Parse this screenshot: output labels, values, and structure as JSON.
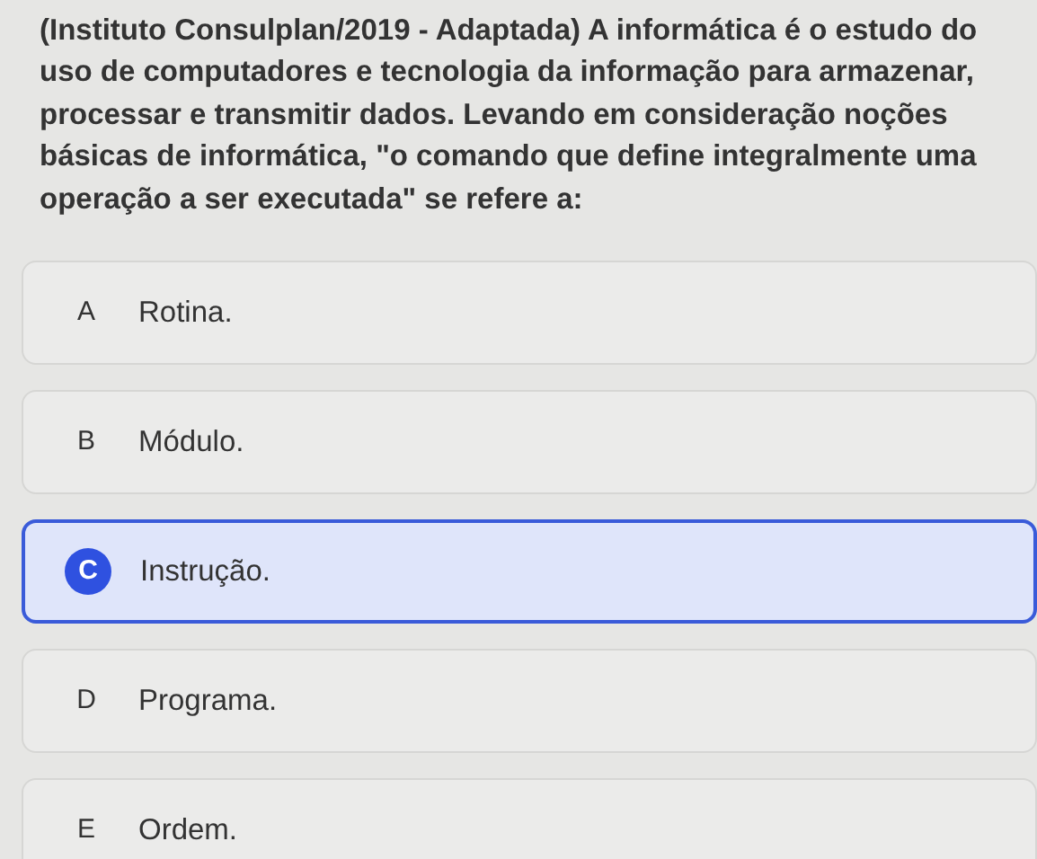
{
  "question": "(Instituto Consulplan/2019 - Adaptada) A informática é o estudo do uso de computadores e tecnologia da informação para armazenar, processar e transmitir dados. Levando em consideração noções básicas de informática, \"o comando que define integralmente uma operação a ser executada\" se refere a:",
  "options": [
    {
      "letter": "A",
      "text": "Rotina.",
      "selected": false
    },
    {
      "letter": "B",
      "text": "Módulo.",
      "selected": false
    },
    {
      "letter": "C",
      "text": "Instrução.",
      "selected": true
    },
    {
      "letter": "D",
      "text": "Programa.",
      "selected": false
    },
    {
      "letter": "E",
      "text": "Ordem.",
      "selected": false
    }
  ]
}
